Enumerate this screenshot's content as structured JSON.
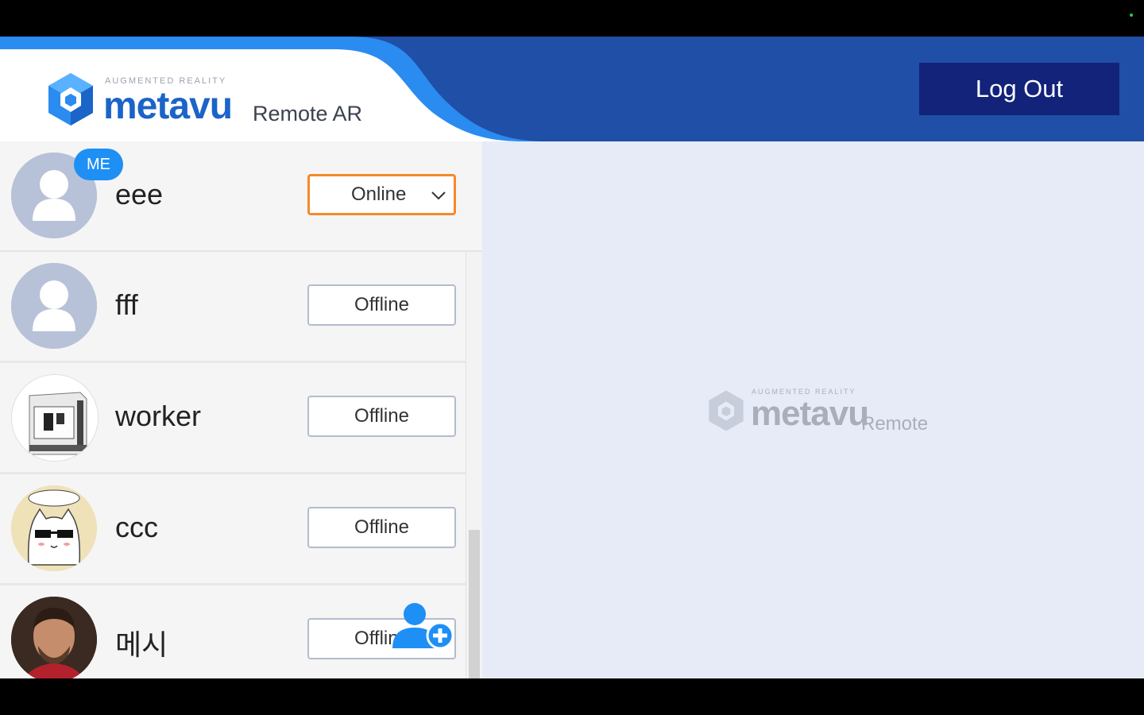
{
  "brand": {
    "tagline": "AUGMENTED REALITY",
    "name": "metavu",
    "product": "Remote AR",
    "watermark_tagline": "AUGMENTED REALITY",
    "watermark_name": "metavu",
    "watermark_product": "Remote"
  },
  "header": {
    "logout_label": "Log Out"
  },
  "me": {
    "badge": "ME",
    "name": "eee",
    "status": "Online"
  },
  "contacts": [
    {
      "name": "fff",
      "status": "Offline"
    },
    {
      "name": "worker",
      "status": "Offline"
    },
    {
      "name": "ccc",
      "status": "Offline"
    },
    {
      "name": "메시",
      "status": "Offline"
    }
  ],
  "icons": {
    "logo": "hexagon-cube-icon",
    "default_avatar": "person-icon",
    "dropdown": "chevron-down-icon",
    "add_friend": "add-person-icon"
  },
  "colors": {
    "header_blue": "#1f4fa6",
    "accent_blue": "#1e8ff5",
    "logout_bg": "#13237a",
    "dropdown_border": "#f5892b",
    "main_bg": "#e6ebf7"
  }
}
